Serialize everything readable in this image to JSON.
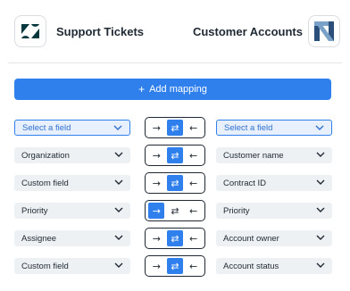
{
  "header": {
    "left_app": {
      "name": "Support Tickets",
      "logo_icon": "zendesk-logo-icon",
      "logo_color": "#03363d"
    },
    "right_app": {
      "name": "Customer Accounts",
      "logo_icon": "netsuite-logo-icon",
      "logo_color": "#1e3a5f"
    }
  },
  "add_mapping": {
    "label": "Add mapping",
    "icon": "plus-icon"
  },
  "direction_icons": {
    "to_right": "→",
    "both": "⇄",
    "to_left": "←"
  },
  "accent_color": "#2f80ed",
  "mappings": [
    {
      "left": "Select a field",
      "right": "Select a field",
      "direction": "both",
      "is_selector": true
    },
    {
      "left": "Organization",
      "right": "Customer name",
      "direction": "both",
      "is_selector": false
    },
    {
      "left": "Custom field",
      "right": "Contract ID",
      "direction": "both",
      "is_selector": false
    },
    {
      "left": "Priority",
      "right": "Priority",
      "direction": "to_right",
      "is_selector": false
    },
    {
      "left": "Assignee",
      "right": "Account owner",
      "direction": "both",
      "is_selector": false
    },
    {
      "left": "Custom field",
      "right": "Account status",
      "direction": "both",
      "is_selector": false
    }
  ]
}
